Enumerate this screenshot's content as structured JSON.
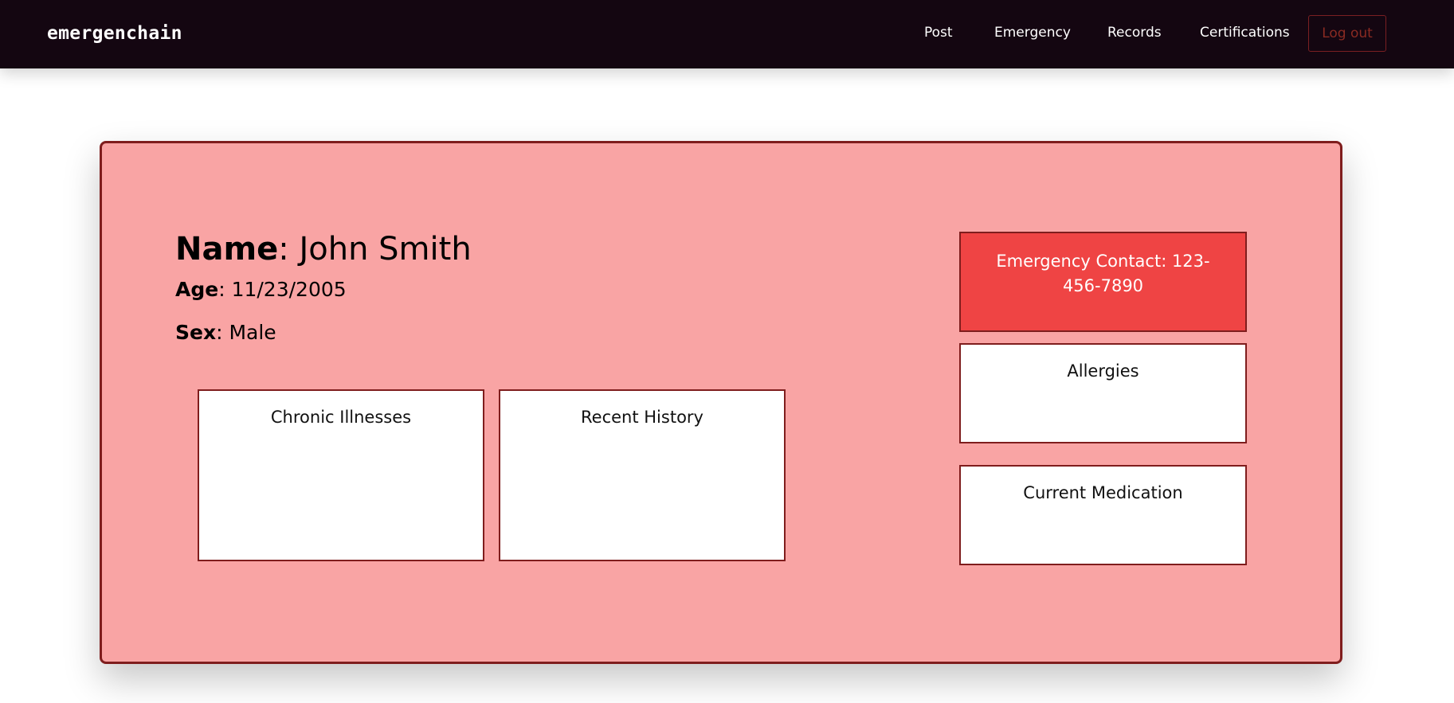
{
  "navbar": {
    "brand": "emergenchain",
    "links": [
      {
        "label": "Post"
      },
      {
        "label": "Emergency"
      },
      {
        "label": "Records"
      },
      {
        "label": "Certifications"
      }
    ],
    "logout_label": "Log out"
  },
  "patient": {
    "name_label": "Name",
    "name_value": ": John Smith",
    "age_label": "Age",
    "age_value": ": 11/23/2005",
    "sex_label": "Sex",
    "sex_value": ": Male"
  },
  "panels": {
    "chronic_title": "Chronic Illnesses",
    "recent_title": "Recent History",
    "emergency_contact": "Emergency Contact: 123-456-7890",
    "allergies_title": "Allergies",
    "medication_title": "Current Medication"
  },
  "colors": {
    "navbar_bg": "#140611",
    "card_bg": "#f9a4a4",
    "card_border": "#7f1d1d",
    "emergency_bg": "#ef4444",
    "logout_text": "#8a2a22"
  }
}
